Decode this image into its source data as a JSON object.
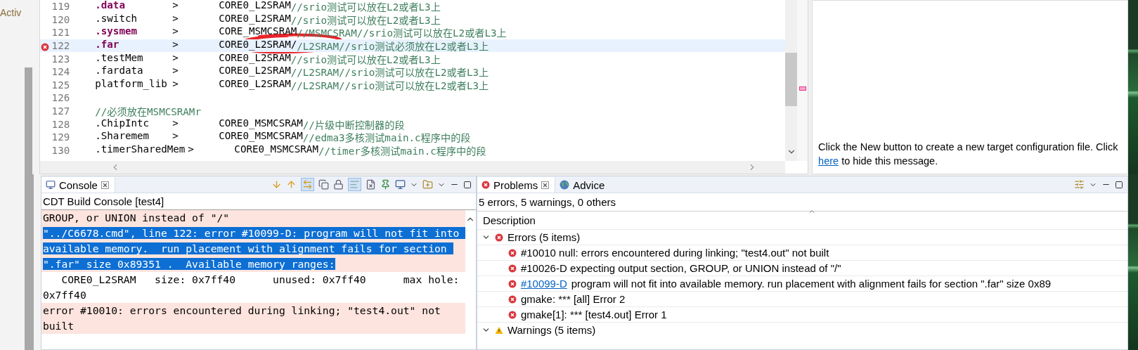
{
  "left_strip": {
    "label": "Activ"
  },
  "editor": {
    "lines": [
      {
        "number": "119",
        "kind": "mapping",
        "section": ".data",
        "keyword": true,
        "arrow": ">",
        "memory": "CORE0_L2SRAM",
        "comment": "//srio测试可以放在L2或者L3上",
        "selected": false,
        "error": false
      },
      {
        "number": "120",
        "kind": "mapping",
        "section": ".switch",
        "keyword": false,
        "arrow": ">",
        "memory": "CORE0_L2SRAM",
        "comment": "//srio测试可以放在L2或者L3上",
        "selected": false,
        "error": false
      },
      {
        "number": "121",
        "kind": "mapping",
        "section": ".sysmem",
        "keyword": true,
        "arrow": ">",
        "memory": "CORE_MSMCSRAM",
        "comment": "//MSMCSRAM//srio测试可以放在L2或者L3上",
        "selected": false,
        "error": false
      },
      {
        "number": "122",
        "kind": "mapping",
        "section": ".far",
        "keyword": true,
        "arrow": ">",
        "memory": "CORE0_L2SRAM/",
        "comment": "/L2SRAM//srio测试必须放在L2或者L3上",
        "selected": true,
        "error": true
      },
      {
        "number": "123",
        "kind": "mapping",
        "section": ".testMem",
        "keyword": false,
        "arrow": ">",
        "memory": "CORE0_L2SRAM",
        "comment": "//srio测试可以放在L2或者L3上",
        "selected": false,
        "error": false
      },
      {
        "number": "124",
        "kind": "mapping",
        "section": ".fardata",
        "keyword": false,
        "arrow": ">",
        "memory": "CORE0_L2SRAM",
        "comment": "//L2SRAM//srio测试可以放在L2或者L3上",
        "selected": false,
        "error": false
      },
      {
        "number": "125",
        "kind": "mapping",
        "section": "platform_lib",
        "keyword": false,
        "arrow": ">",
        "memory": "CORE0_L2SRAM",
        "comment": "//L2SRAM//srio测试可以放在L2或者L3上",
        "selected": false,
        "error": false
      },
      {
        "number": "126",
        "kind": "blank",
        "selected": false,
        "error": false
      },
      {
        "number": "127",
        "kind": "comment",
        "comment": "//必须放在MSMCSRAMr",
        "selected": false,
        "error": false
      },
      {
        "number": "128",
        "kind": "mapping",
        "section": ".ChipIntc",
        "keyword": false,
        "arrow": ">",
        "memory": "CORE0_MSMCSRAM",
        "comment": "//片级中断控制器的段",
        "selected": false,
        "error": false
      },
      {
        "number": "129",
        "kind": "mapping",
        "section": ".Sharemem",
        "keyword": false,
        "arrow": ">",
        "memory": "CORE0_MSMCSRAM",
        "comment": "//edma3多核测试main.c程序中的段",
        "selected": false,
        "error": false
      },
      {
        "number": "130",
        "kind": "mapping",
        "section": ".timerSharedMem",
        "keyword": false,
        "arrow": ">",
        "memory": "CORE0_MSMCSRAM",
        "comment": "//timer多核测试main.c程序中的段",
        "selected": false,
        "error": false
      }
    ]
  },
  "target_panel": {
    "message_before": "Click the New button to create a new target configuration file. Click ",
    "link": "here",
    "message_after": " to hide this message."
  },
  "console": {
    "tabs": [
      {
        "label": "Console",
        "selected": true
      }
    ],
    "title": "CDT Build Console [test4]",
    "lines": [
      {
        "kind": "error",
        "selected": false,
        "text": "GROUP, or UNION instead of \"/\""
      },
      {
        "kind": "error",
        "selected": true,
        "text": "\"../C6678.cmd\", line 122: error #10099-D: program will not fit into available memory.  run placement with alignment fails for section \".far\" size 0x89351 .  Available memory ranges:"
      },
      {
        "kind": "plain",
        "selected": false,
        "text": "   CORE0_L2SRAM   size: 0x7ff40      unused: 0x7ff40      max hole: 0x7ff40"
      },
      {
        "kind": "error",
        "selected": false,
        "text": "error #10010: errors encountered during linking; \"test4.out\" not built"
      }
    ]
  },
  "problems": {
    "tabs": [
      {
        "label": "Problems",
        "selected": true
      },
      {
        "label": "Advice",
        "selected": false
      }
    ],
    "summary": "5 errors, 5 warnings, 0 others",
    "columns": [
      "Description"
    ],
    "groups": [
      {
        "kind": "error",
        "label": "Errors (5 items)",
        "expanded": true,
        "children": [
          {
            "text": "#10010 null: errors encountered during linking; \"test4.out\" not built"
          },
          {
            "text": "#10026-D expecting output section, GROUP, or UNION instead of \"/\""
          },
          {
            "link": "#10099-D",
            "text": "program will not fit into available memory.  run placement with alignment fails for section \".far\" size 0x89"
          },
          {
            "text": "gmake: *** [all] Error 2"
          },
          {
            "text": "gmake[1]: *** [test4.out] Error 1"
          }
        ]
      },
      {
        "kind": "warning",
        "label": "Warnings (5 items)",
        "expanded": true
      }
    ]
  }
}
